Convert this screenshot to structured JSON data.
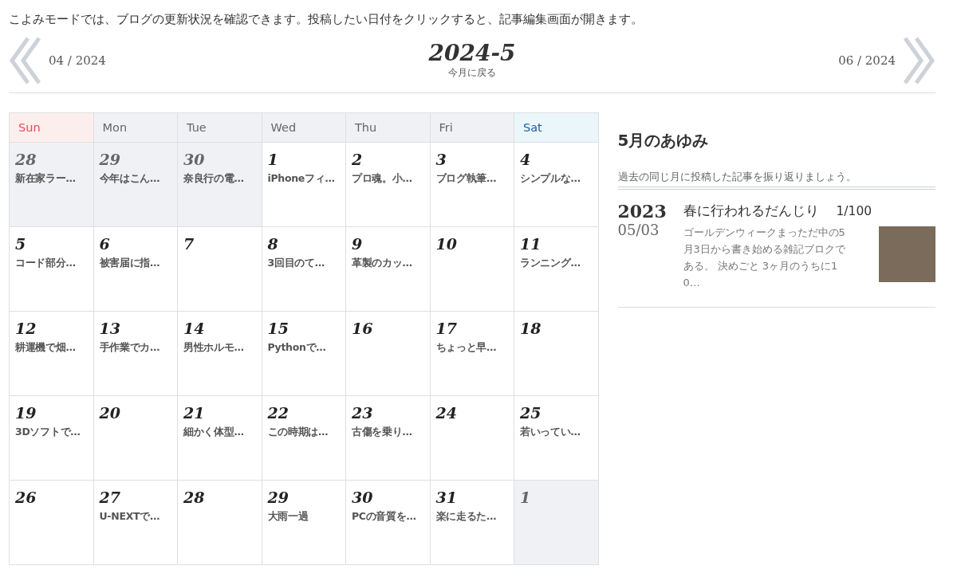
{
  "intro": "こよみモードでは、ブログの更新状況を確認できます。投稿したい日付をクリックすると、記事編集画面が開きます。",
  "nav": {
    "prev": "04 / 2024",
    "current": "2024-5",
    "back_label": "今月に戻る",
    "next": "06 / 2024"
  },
  "calendar": {
    "weekdays": [
      {
        "label": "Sun",
        "kind": "sunday"
      },
      {
        "label": "Mon",
        "kind": "weekday"
      },
      {
        "label": "Tue",
        "kind": "weekday"
      },
      {
        "label": "Wed",
        "kind": "weekday"
      },
      {
        "label": "Thu",
        "kind": "weekday"
      },
      {
        "label": "Fri",
        "kind": "weekday"
      },
      {
        "label": "Sat",
        "kind": "saturday"
      }
    ],
    "days": [
      {
        "day": "28",
        "post": "新在家ラー…",
        "outside": true
      },
      {
        "day": "29",
        "post": "今年はこん…",
        "outside": true
      },
      {
        "day": "30",
        "post": "奈良行の電…",
        "outside": true
      },
      {
        "day": "1",
        "post": "iPhoneフィ…",
        "outside": false
      },
      {
        "day": "2",
        "post": "プロ魂。小…",
        "outside": false
      },
      {
        "day": "3",
        "post": "ブログ執筆…",
        "outside": false
      },
      {
        "day": "4",
        "post": "シンプルな…",
        "outside": false
      },
      {
        "day": "5",
        "post": "コード部分…",
        "outside": false
      },
      {
        "day": "6",
        "post": "被害届に指…",
        "outside": false
      },
      {
        "day": "7",
        "outside": false
      },
      {
        "day": "8",
        "post": "3回目のて…",
        "outside": false
      },
      {
        "day": "9",
        "post": "革製のカッ…",
        "outside": false
      },
      {
        "day": "10",
        "outside": false
      },
      {
        "day": "11",
        "post": "ランニング…",
        "outside": false
      },
      {
        "day": "12",
        "post": "耕運機で畑…",
        "outside": false
      },
      {
        "day": "13",
        "post": "手作業でカ…",
        "outside": false
      },
      {
        "day": "14",
        "post": "男性ホルモ…",
        "outside": false
      },
      {
        "day": "15",
        "post": "Pythonで…",
        "outside": false
      },
      {
        "day": "16",
        "outside": false
      },
      {
        "day": "17",
        "post": "ちょっと早…",
        "outside": false
      },
      {
        "day": "18",
        "outside": false
      },
      {
        "day": "19",
        "post": "3Dソフトで…",
        "outside": false
      },
      {
        "day": "20",
        "outside": false
      },
      {
        "day": "21",
        "post": "細かく体型…",
        "outside": false
      },
      {
        "day": "22",
        "post": "この時期は…",
        "outside": false
      },
      {
        "day": "23",
        "post": "古傷を乗り…",
        "outside": false
      },
      {
        "day": "24",
        "outside": false
      },
      {
        "day": "25",
        "post": "若いってい…",
        "outside": false
      },
      {
        "day": "26",
        "outside": false
      },
      {
        "day": "27",
        "post": "U-NEXTで…",
        "outside": false
      },
      {
        "day": "28",
        "outside": false
      },
      {
        "day": "29",
        "post": "大雨一過",
        "outside": false
      },
      {
        "day": "30",
        "post": "PCの音質を…",
        "outside": false
      },
      {
        "day": "31",
        "post": "楽に走るた…",
        "outside": false
      },
      {
        "day": "1",
        "outside": true
      }
    ]
  },
  "history": {
    "title": "5月のあゆみ",
    "subtitle": "過去の同じ月に投稿した記事を振り返りましょう。",
    "entries": [
      {
        "year": "2023",
        "date": "05/03",
        "title": "春に行われるだんじり",
        "count": "1/100",
        "excerpt": "ゴールデンウィークまっただ中の5月3日から書き始める雑記ブロクである。 決めごと 3ヶ月のうちに10…"
      }
    ]
  }
}
